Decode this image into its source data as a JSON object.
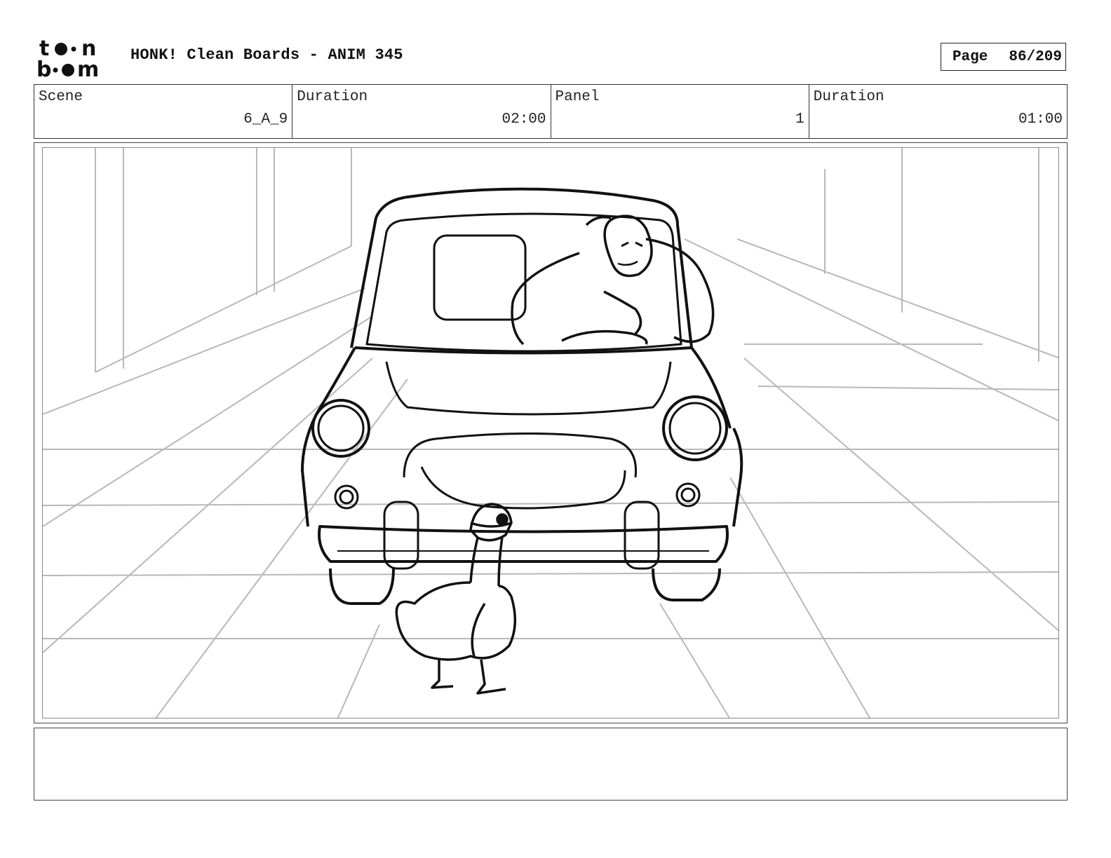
{
  "header": {
    "logo_text": "toon boom",
    "title": "HONK! Clean Boards - ANIM 345",
    "page_label": "Page",
    "page_value": "86/209"
  },
  "info": {
    "scene_label": "Scene",
    "scene_value": "6_A_9",
    "scene_duration_label": "Duration",
    "scene_duration_value": "02:00",
    "panel_label": "Panel",
    "panel_value": "1",
    "panel_duration_label": "Duration",
    "panel_duration_value": "01:00"
  },
  "panel": {
    "illustration": "goose-in-front-of-car",
    "drawing_color": "#111111",
    "background_sketch_color": "#b8b8b8"
  },
  "notes": {
    "text": ""
  }
}
